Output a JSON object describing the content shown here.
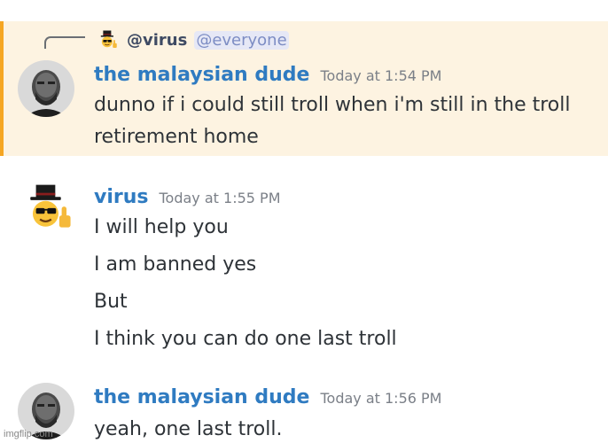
{
  "reply": {
    "author": "@virus",
    "mention": "@everyone"
  },
  "messages": [
    {
      "author": "the malaysian dude",
      "timestamp": "Today at 1:54 PM",
      "lines": [
        "dunno if i could still troll when i'm still in the troll",
        "retirement home"
      ],
      "highlighted": true
    },
    {
      "author": "virus",
      "timestamp": "Today at 1:55 PM",
      "lines": [
        "I will help you",
        "I am banned yes",
        "But",
        "I think you can do one last troll"
      ]
    },
    {
      "author": "the malaysian dude",
      "timestamp": "Today at 1:56 PM",
      "lines": [
        "yeah, one last troll."
      ]
    }
  ],
  "watermark": "imgflip.com",
  "colors": {
    "highlight_bg": "#fdf3e1",
    "highlight_bar": "#f5a623",
    "username": "#2f7bc1",
    "timestamp": "#7a7f87",
    "text": "#2e3338",
    "mention_bg": "#e6e8f6",
    "mention_text": "#7d8dc4"
  },
  "icons": {
    "virus_avatar": "sunglasses-top-hat-thumbs-up-icon",
    "dude_avatar": "bearded-man-photo-icon"
  }
}
